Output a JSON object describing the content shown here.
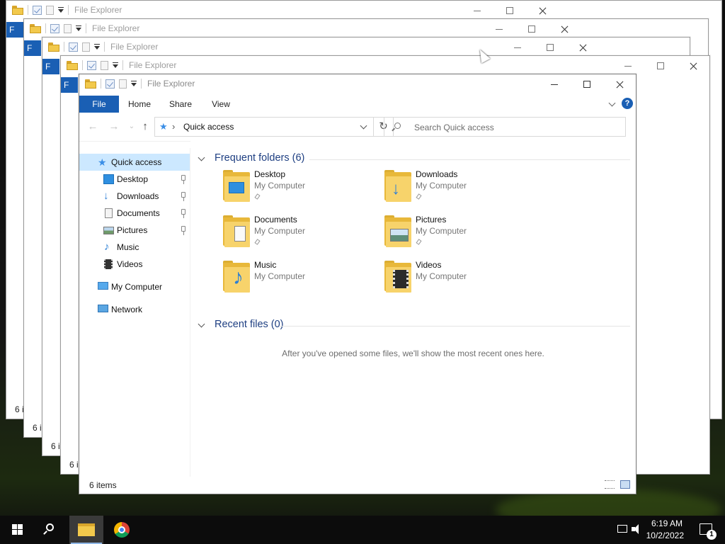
{
  "window": {
    "title": "File Explorer",
    "ribbon_tabs": [
      "File",
      "Home",
      "Share",
      "View"
    ],
    "help_label": "?"
  },
  "navbar": {
    "address_text": "Quick access",
    "search_placeholder": "Search Quick access"
  },
  "sidebar": {
    "items": [
      {
        "label": "Quick access",
        "icon": "quick-access-star-icon",
        "selected": true
      },
      {
        "label": "Desktop",
        "icon": "desktop-icon",
        "pinned": true
      },
      {
        "label": "Downloads",
        "icon": "downloads-icon",
        "pinned": true
      },
      {
        "label": "Documents",
        "icon": "documents-icon",
        "pinned": true
      },
      {
        "label": "Pictures",
        "icon": "pictures-icon",
        "pinned": true
      },
      {
        "label": "Music",
        "icon": "music-icon"
      },
      {
        "label": "Videos",
        "icon": "videos-icon"
      },
      {
        "label": "My Computer",
        "icon": "computer-icon"
      },
      {
        "label": "Network",
        "icon": "network-icon"
      }
    ]
  },
  "main": {
    "frequent_title": "Frequent folders (6)",
    "recent_title": "Recent files (0)",
    "recent_empty": "After you've opened some files, we'll show the most recent ones here.",
    "folders": [
      {
        "name": "Desktop",
        "location": "My Computer",
        "pinned": true,
        "badge": "desktop"
      },
      {
        "name": "Downloads",
        "location": "My Computer",
        "pinned": true,
        "badge": "download"
      },
      {
        "name": "Documents",
        "location": "My Computer",
        "pinned": true,
        "badge": "document"
      },
      {
        "name": "Pictures",
        "location": "My Computer",
        "pinned": true,
        "badge": "picture"
      },
      {
        "name": "Music",
        "location": "My Computer",
        "pinned": false,
        "badge": "music"
      },
      {
        "name": "Videos",
        "location": "My Computer",
        "pinned": false,
        "badge": "video"
      }
    ]
  },
  "status": {
    "item_count": "6 items",
    "bg_item_count": "6 i"
  },
  "background_windows": {
    "tab_stub": "F"
  },
  "taskbar": {
    "time": "6:19 AM",
    "date": "10/2/2022",
    "notification_count": "1",
    "apps": [
      "file-explorer-icon",
      "chrome-icon"
    ]
  },
  "colors": {
    "accent": "#1a5fb4",
    "selection": "#cce8ff",
    "folder": "#f7d36b",
    "group_title": "#1e3f82"
  }
}
